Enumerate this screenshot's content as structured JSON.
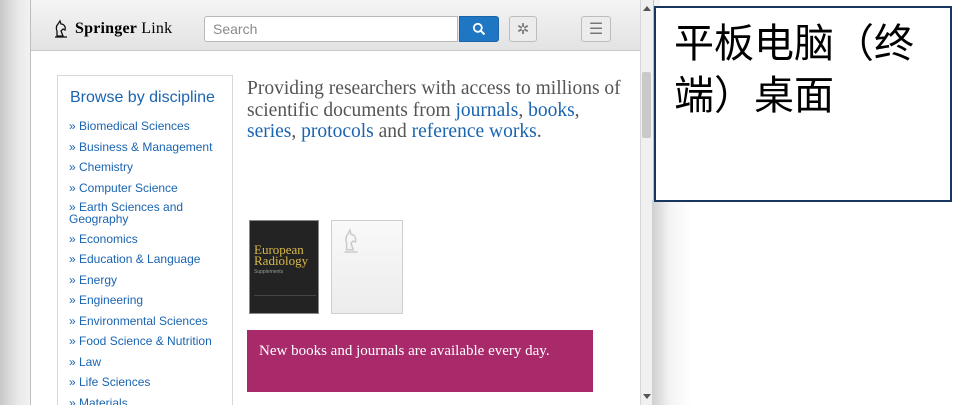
{
  "header": {
    "logo_text_bold": "Springer",
    "logo_text_regular": "Link",
    "search_placeholder": "Search"
  },
  "sidebar": {
    "title": "Browse by discipline",
    "items": [
      "» Biomedical Sciences",
      "» Business & Management",
      "» Chemistry",
      "» Computer Science",
      "» Earth Sciences and Geography",
      "» Economics",
      "» Education & Language",
      "» Energy",
      "» Engineering",
      "» Environmental Sciences",
      "» Food Science & Nutrition",
      "» Law",
      "» Life Sciences",
      "» Materials"
    ]
  },
  "intro": {
    "part1": "Providing researchers with access to millions of scientific documents from ",
    "link_journals": "journals",
    "sep1": ", ",
    "link_books": "books",
    "sep2": ", ",
    "link_series": "series",
    "sep3": ", ",
    "link_protocols": "protocols",
    "sep4": " and ",
    "link_reference_works": "reference works",
    "end": "."
  },
  "covers": {
    "er_title": "European Radiology",
    "er_subtitle": "Supplements"
  },
  "notice": {
    "text": "New books and journals are available every day."
  },
  "overlay": {
    "text": "平板电脑（终端）桌面"
  },
  "colors": {
    "link": "#1a64b0",
    "search_button": "#1f76c2",
    "notice_bg": "#a82a6b",
    "overlay_border": "#17365d"
  }
}
